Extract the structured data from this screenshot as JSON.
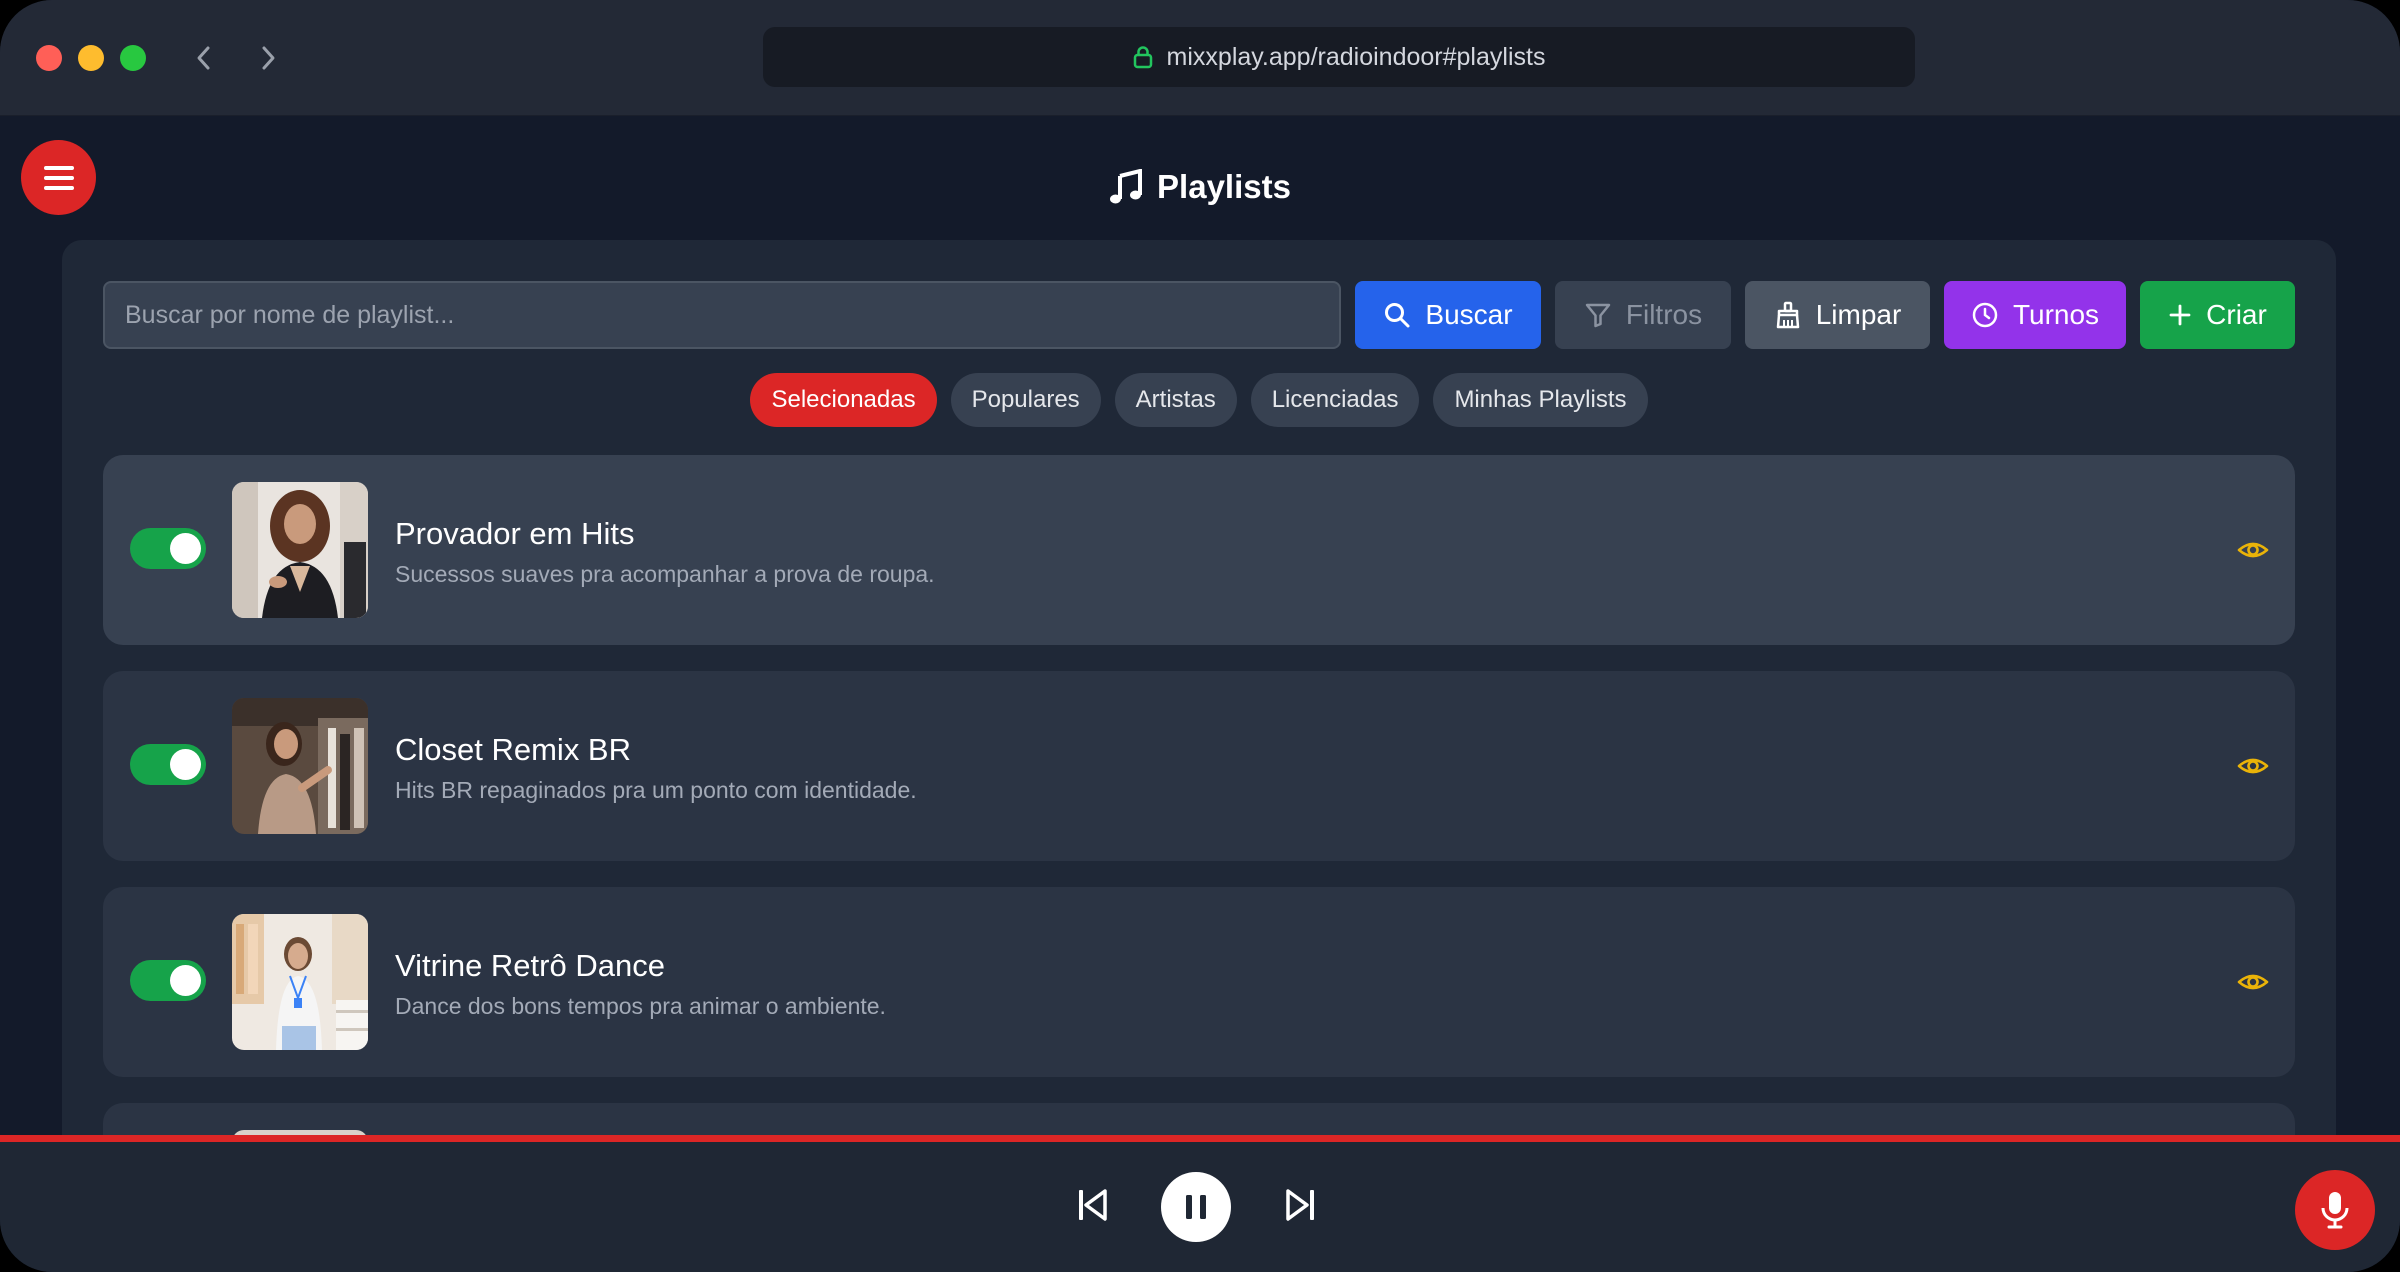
{
  "browser": {
    "url": "mixxplay.app/radioindoor#playlists"
  },
  "page": {
    "title": "Playlists"
  },
  "toolbar": {
    "search_placeholder": "Buscar por nome de playlist...",
    "buscar_label": "Buscar",
    "filtros_label": "Filtros",
    "limpar_label": "Limpar",
    "turnos_label": "Turnos",
    "criar_label": "Criar"
  },
  "tabs": [
    {
      "label": "Selecionadas",
      "active": true
    },
    {
      "label": "Populares",
      "active": false
    },
    {
      "label": "Artistas",
      "active": false
    },
    {
      "label": "Licenciadas",
      "active": false
    },
    {
      "label": "Minhas Playlists",
      "active": false
    }
  ],
  "playlists": [
    {
      "title": "Provador em Hits",
      "description": "Sucessos suaves pra acompanhar a prova de roupa.",
      "enabled": true
    },
    {
      "title": "Closet Remix BR",
      "description": "Hits BR repaginados pra um ponto com identidade.",
      "enabled": true
    },
    {
      "title": "Vitrine Retrô Dance",
      "description": "Dance dos bons tempos pra animar o ambiente.",
      "enabled": true
    }
  ],
  "colors": {
    "accent_red": "#dc2626",
    "blue": "#2563eb",
    "purple": "#9333ea",
    "green": "#16a34a",
    "eye_yellow": "#eab308"
  },
  "icons": {
    "menu": "hamburger-icon",
    "title": "music-note-icon",
    "search": "search-icon",
    "filter": "funnel-icon",
    "clear": "broom-icon",
    "shifts": "clock-icon",
    "create": "plus-icon",
    "view": "eye-icon",
    "prev": "skip-previous-icon",
    "pause": "pause-icon",
    "next": "skip-next-icon",
    "mic": "microphone-icon"
  }
}
